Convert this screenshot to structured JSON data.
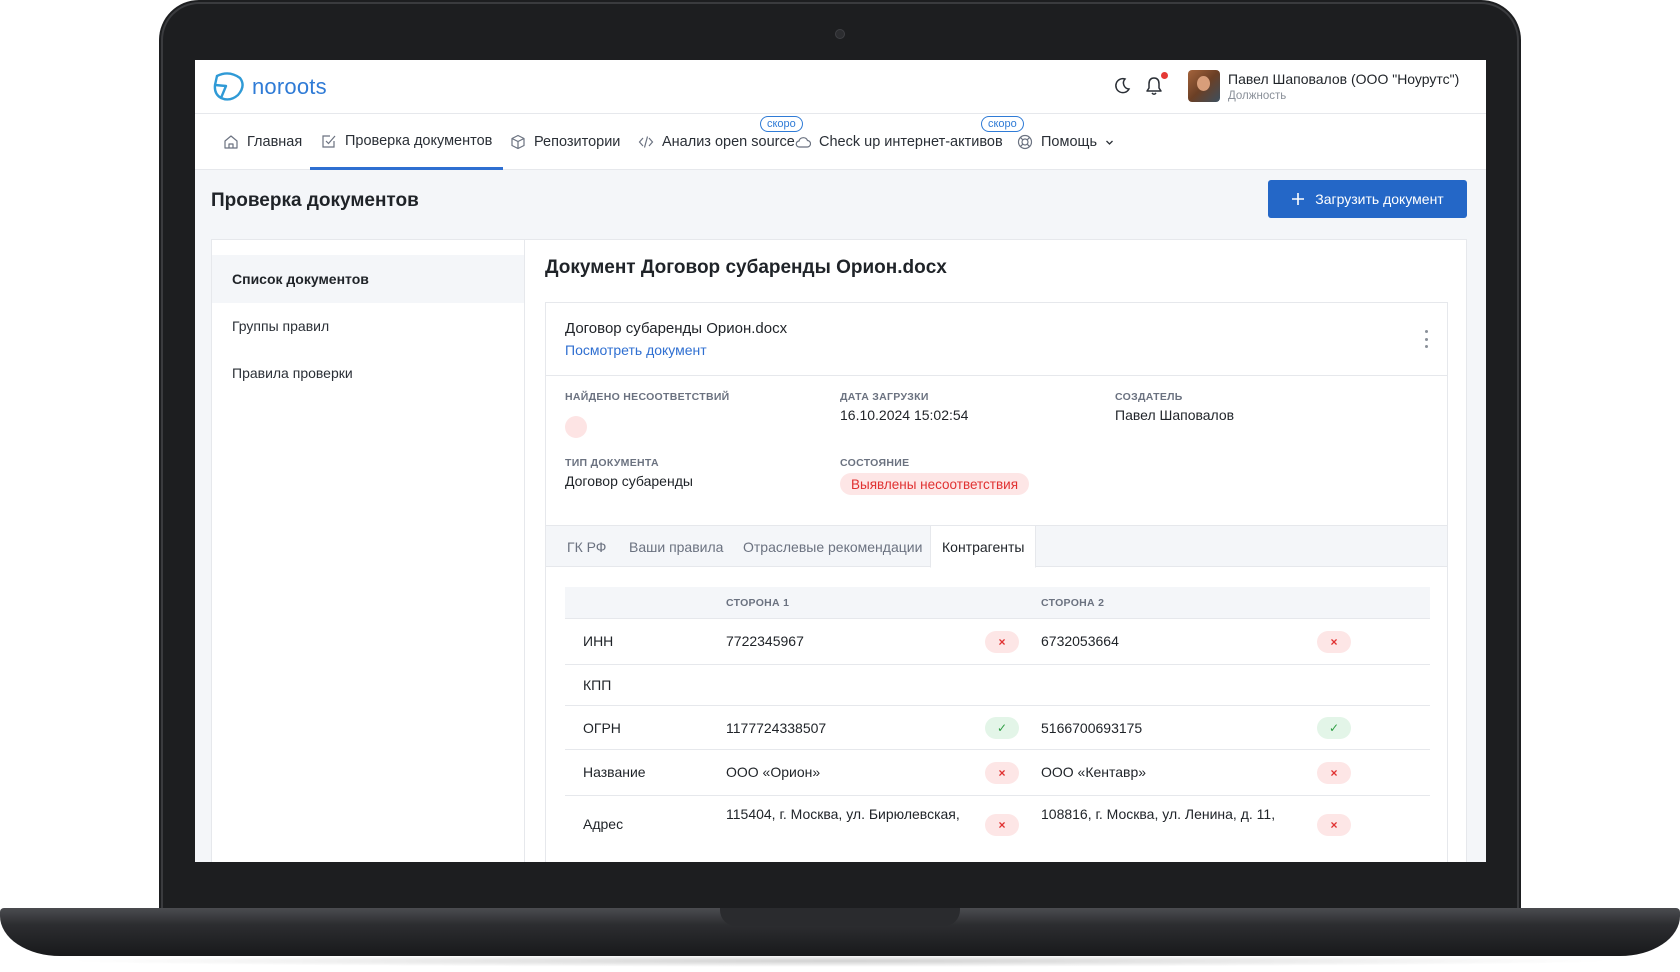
{
  "header": {
    "logo_text": "noroots",
    "user_name": "Павел Шаповалов (ООО \"Ноурутс\")",
    "user_role": "Должность"
  },
  "nav": {
    "items": [
      {
        "label": "Главная",
        "icon": "home-icon"
      },
      {
        "label": "Проверка документов",
        "icon": "doc-check-icon"
      },
      {
        "label": "Репозитории",
        "icon": "box-icon"
      },
      {
        "label": "Анализ open source",
        "icon": "code-icon"
      },
      {
        "label": "Check up интернет-активов",
        "icon": "cloud-icon"
      },
      {
        "label": "Помощь",
        "icon": "lifebuoy-icon"
      }
    ],
    "soon_badge": "скоро"
  },
  "page": {
    "title": "Проверка документов",
    "upload_button": "Загрузить документ"
  },
  "sidebar": {
    "items": [
      {
        "label": "Список документов"
      },
      {
        "label": "Группы правил"
      },
      {
        "label": "Правила проверки"
      }
    ]
  },
  "document": {
    "heading": "Документ Договор субаренды Орион.docx",
    "file_name": "Договор субаренды Орион.docx",
    "view_link": "Посмотреть документ",
    "meta": {
      "found_label": "Найдено несоответствий",
      "date_label": "Дата загрузки",
      "date_value": "16.10.2024 15:02:54",
      "author_label": "Создатель",
      "author_value": "Павел Шаповалов",
      "type_label": "Тип документа",
      "type_value": "Договор субаренды",
      "status_label": "Состояние",
      "status_value": "Выявлены несоответствия"
    },
    "tabs": [
      {
        "label": "ГК РФ"
      },
      {
        "label": "Ваши правила"
      },
      {
        "label": "Отраслевые рекомендации"
      },
      {
        "label": "Контрагенты"
      }
    ],
    "table": {
      "col_side1": "Сторона 1",
      "col_side2": "Сторона 2",
      "rows": [
        {
          "field": "ИНН",
          "side1": "7722345967",
          "side1_ok": false,
          "side2": "6732053664",
          "side2_ok": false
        },
        {
          "field": "КПП",
          "side1": "",
          "side1_ok": null,
          "side2": "",
          "side2_ok": null
        },
        {
          "field": "ОГРН",
          "side1": "1177724338507",
          "side1_ok": true,
          "side2": "5166700693175",
          "side2_ok": true
        },
        {
          "field": "Название",
          "side1": "ООО «Орион»",
          "side1_ok": false,
          "side2": "ООО «Кентавр»",
          "side2_ok": false
        },
        {
          "field": "Адрес",
          "side1": "115404, г. Москва, ул. Бирюлевская,",
          "side1_ok": false,
          "side2": "108816, г. Москва, ул. Ленина, д. 11,",
          "side2_ok": false
        }
      ]
    },
    "marks": {
      "yes": "✓",
      "no": "×"
    }
  }
}
